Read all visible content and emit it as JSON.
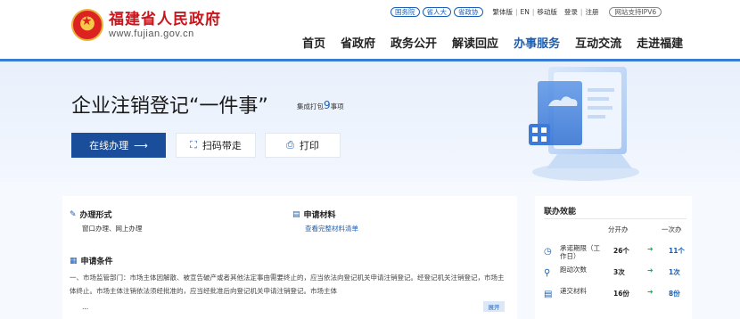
{
  "header": {
    "site_title": "福建省人民政府",
    "site_url": "www.fujian.gov.cn",
    "top_pills": [
      "国务院",
      "省人大",
      "省政协"
    ],
    "top_links": [
      "繁体版",
      "EN",
      "移动版"
    ],
    "account_links": [
      "登录",
      "注册"
    ],
    "ipv6": "网站支持IPV6",
    "nav": [
      "首页",
      "省政府",
      "政务公开",
      "解读回应",
      "办事服务",
      "互动交流",
      "走进福建"
    ],
    "active_nav_index": 4
  },
  "banner": {
    "title": "企业注销登记“一件事”",
    "sub_prefix": "集成打包",
    "sub_count": "9",
    "sub_suffix": "事项",
    "online_button": "在线办理",
    "scan_button": "扫码带走",
    "print_button": "打印"
  },
  "details": {
    "method_heading": "办理形式",
    "method_value": "窗口办理、网上办理",
    "materials_heading": "申请材料",
    "materials_link": "查看完整材料清单",
    "conditions_heading": "申请条件",
    "conditions_text": "一、市场监管部门：市场主体因解散、被宣告破产或者其他法定事由需要终止的，应当依法向登记机关申请注销登记。经登记机关注销登记，市场主体终止。市场主体注销依法须经批准的，应当经批准后向登记机关申请注销登记。市场主体",
    "ellipsis": "...",
    "expand_button": "展开"
  },
  "efficiency": {
    "title": "联办效能",
    "col_separate": "分开办",
    "col_once": "一次办",
    "rows": [
      {
        "icon": "clock-icon",
        "label": "承诺期限（工作日）",
        "separate": "26个",
        "once": "11个"
      },
      {
        "icon": "walk-icon",
        "label": "跑动次数",
        "separate": "3次",
        "once": "1次"
      },
      {
        "icon": "document-icon",
        "label": "递交材料",
        "separate": "16份",
        "once": "8份"
      }
    ]
  },
  "colors": {
    "primary": "#1a4e9a",
    "accent_blue": "#1b5fb4",
    "brand_red": "#c8161d",
    "green_arrow": "#22a35a"
  }
}
